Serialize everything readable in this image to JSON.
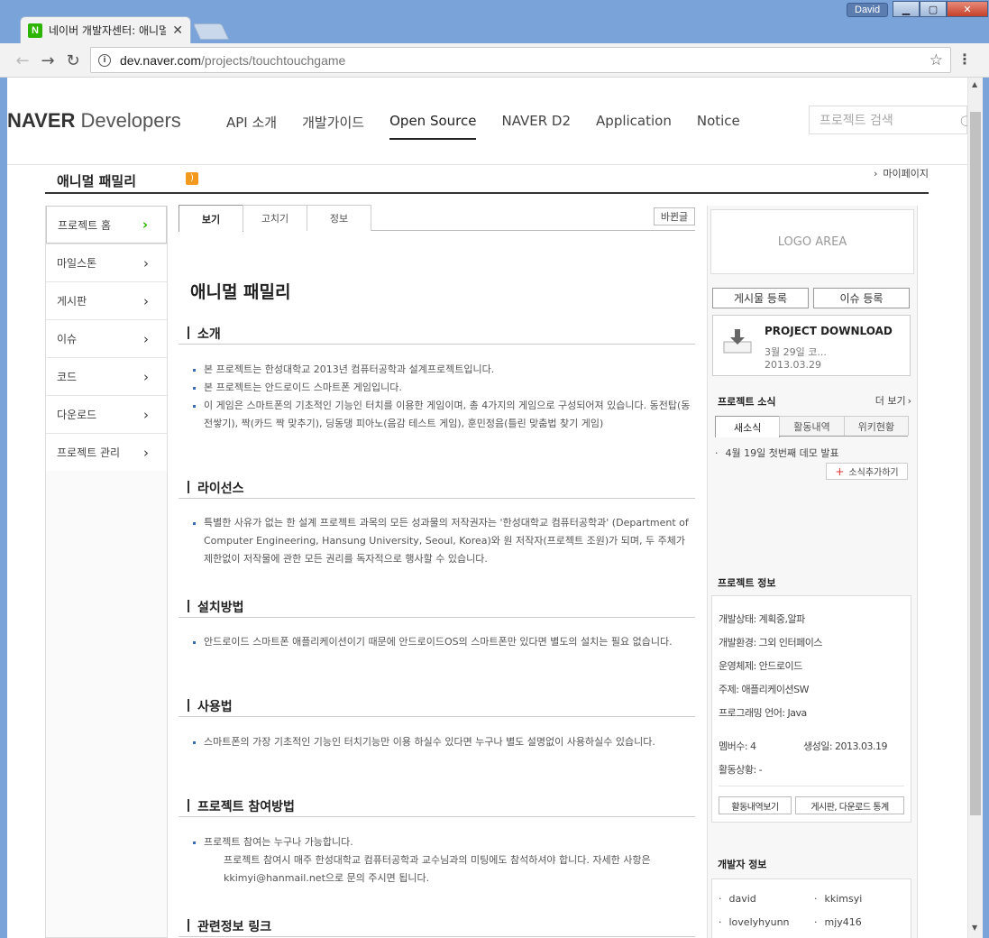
{
  "browser": {
    "tab_title": "네이버 개발자센터: 애니멀 패밀리",
    "tab_favicon": "N",
    "user": "David",
    "url_host": "dev.naver.com",
    "url_path": "/projects/touchtouchgame",
    "icons": [
      "back-icon",
      "forward-icon",
      "reload-icon",
      "info-icon",
      "star-icon",
      "menu-icon"
    ]
  },
  "gnb": {
    "logo_bold": "NAVER",
    "logo_light": "Developers",
    "menu": [
      "API 소개",
      "개발가이드",
      "Open Source",
      "NAVER D2",
      "Application",
      "Notice"
    ],
    "active_menu": "Open Source",
    "search_placeholder": "프로젝트 검색"
  },
  "project": {
    "name": "애니멀 패밀리",
    "mypage": "마이페이지"
  },
  "lnb": {
    "items": [
      "프로젝트 홈",
      "마일스톤",
      "게시판",
      "이슈",
      "코드",
      "다운로드",
      "프로젝트 관리"
    ],
    "active": "프로젝트 홈"
  },
  "content_tabs": {
    "items": [
      "보기",
      "고치기",
      "정보"
    ],
    "active": "보기",
    "history_button": "바뀐글"
  },
  "doc": {
    "title": "애니멀 패밀리",
    "sections": [
      {
        "title": "소개",
        "items": [
          "본 프로젝트는 한성대학교 2013년 컴퓨터공학과 설계프로젝트입니다.",
          "본 프로젝트는 안드로이드 스마트폰 게임입니다.",
          "이 게임은 스마트폰의 기초적인 기능인 터치를 이용한 게임이며, 총 4가지의 게임으로 구성되어져 있습니다. 동전탑(동전쌓기), 짝(카드 짝 맞추기), 딩동댕 피아노(음감 테스트 게임), 훈민정음(틀린 맞춤법 찾기 게임)"
        ]
      },
      {
        "title": "라이선스",
        "items": [
          "특별한 사유가 없는 한 설계 프로젝트 과목의 모든 성과물의 저작권자는 '한성대학교 컴퓨터공학과' (Department of Computer Engineering, Hansung University, Seoul, Korea)와 원 저작자(프로젝트 조원)가 되며, 두 주체가 제한없이 저작물에 관한 모든 권리를 독자적으로 행사할 수 있습니다."
        ]
      },
      {
        "title": "설치방법",
        "items": [
          "안드로이드 스마트폰 애플리케이션이기 때문에 안드로이드OS의 스마트폰만 있다면 별도의 설치는 필요 없습니다."
        ]
      },
      {
        "title": "사용법",
        "items": [
          "스마트폰의 가장 기초적인 기능인 터치기능만 이용 하실수 있다면 누구나 별도 설명없이 사용하실수 있습니다."
        ]
      },
      {
        "title": "프로젝트 참여방법",
        "items": [
          "프로젝트 참여는 누구나 가능합니다."
        ],
        "note": "프로젝트 참여시 매주 한성대학교 컴퓨터공학과 교수님과의 미팅에도 참석하셔야 합니다. 자세한 사항은 kkimyi@hanmail.net으로 문의 주시면 됩니다."
      },
      {
        "title": "관련정보 링크",
        "items": []
      }
    ]
  },
  "side": {
    "logo_area": "LOGO AREA",
    "post_button": "게시물 등록",
    "issue_button": "이슈 등록",
    "download": {
      "title": "PROJECT DOWNLOAD",
      "subtitle": "3월 29일 코...",
      "date": "2013.03.29"
    },
    "news": {
      "label": "프로젝트 소식",
      "more": "더 보기",
      "tabs": [
        "새소식",
        "활동내역",
        "위키현황"
      ],
      "active_tab": "새소식",
      "items": [
        "4월 19일 첫번째 데모 발표"
      ],
      "add_button": "소식추가하기"
    },
    "info": {
      "label": "프로젝트 정보",
      "rows": [
        "개발상태: 계획중,알파",
        "개발환경: 그외 인터페이스",
        "운영체제: 안드로이드",
        "주제: 애플리케이션SW",
        "프로그래밍 언어: Java"
      ],
      "members": "멤버수: 4",
      "created": "생성일: 2013.03.19",
      "activity": "활동상황: -",
      "activity_button": "활동내역보기",
      "stats_button": "게시판, 다운로드 통계"
    },
    "developers": {
      "label": "개발자 정보",
      "names": [
        "david",
        "kkimsyi",
        "lovelyhyunn",
        "mjy416"
      ]
    }
  }
}
